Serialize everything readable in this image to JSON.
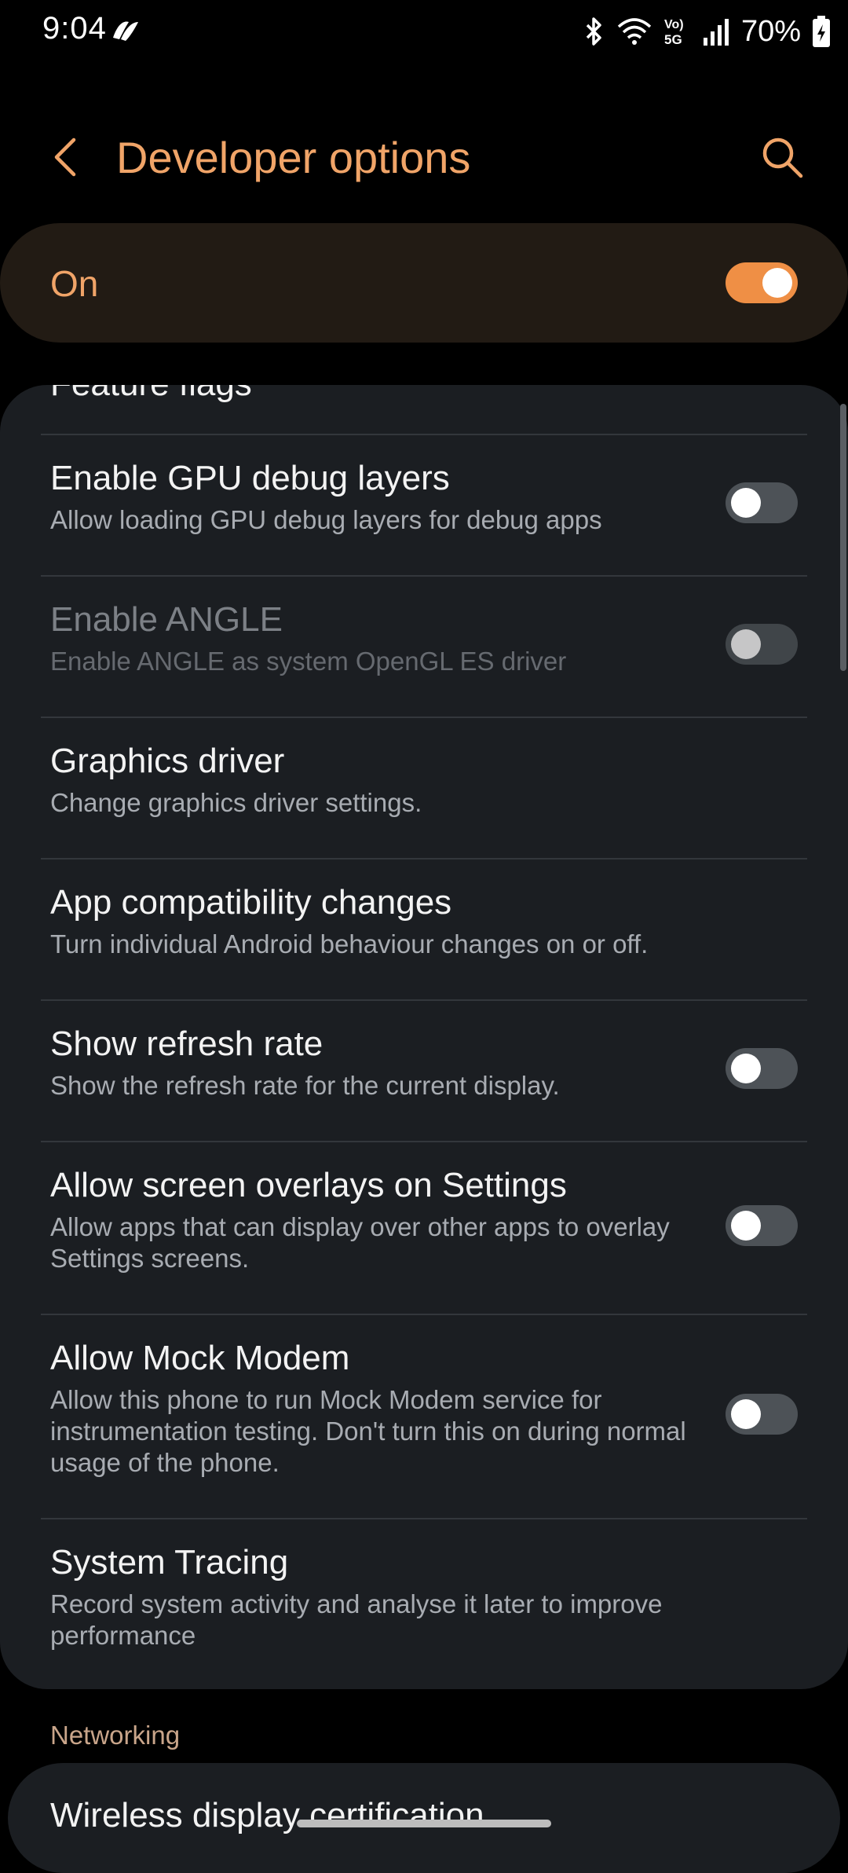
{
  "status_bar": {
    "time": "9:04",
    "battery": "70%",
    "icons": [
      "app-notification-icon",
      "bluetooth-icon",
      "wifi-icon",
      "volte-5g-icon",
      "signal-icon",
      "battery-charging-icon"
    ]
  },
  "header": {
    "title": "Developer options",
    "back_icon": "chevron-left-icon",
    "search_icon": "search-icon"
  },
  "master_switch": {
    "label": "On",
    "checked": true
  },
  "colors": {
    "accent": "#ef8f45",
    "title": "#f0a468",
    "card": "#1b1e22",
    "background": "#000000"
  },
  "settings": {
    "cut_item": "Feature flags",
    "items": [
      {
        "title": "Enable GPU debug layers",
        "summary": "Allow loading GPU debug layers for debug apps",
        "toggle": false
      },
      {
        "title": "Enable ANGLE",
        "summary": "Enable ANGLE as system OpenGL ES driver",
        "toggle": false,
        "disabled": true
      },
      {
        "title": "Graphics driver",
        "summary": "Change graphics driver settings."
      },
      {
        "title": "App compatibility changes",
        "summary": "Turn individual Android behaviour changes on or off."
      },
      {
        "title": "Show refresh rate",
        "summary": "Show the refresh rate for the current display.",
        "toggle": false
      },
      {
        "title": "Allow screen overlays on Settings",
        "summary": "Allow apps that can display over other apps to overlay Settings screens.",
        "toggle": false
      },
      {
        "title": "Allow Mock Modem",
        "summary": "Allow this phone to run Mock Modem service for instrumentation testing. Don't turn this on during normal usage of the phone.",
        "toggle": false
      },
      {
        "title": "System Tracing",
        "summary": "Record system activity and analyse it later to improve performance"
      }
    ]
  },
  "networking": {
    "section_label": "Networking",
    "cut_item": "Wireless display certification"
  }
}
